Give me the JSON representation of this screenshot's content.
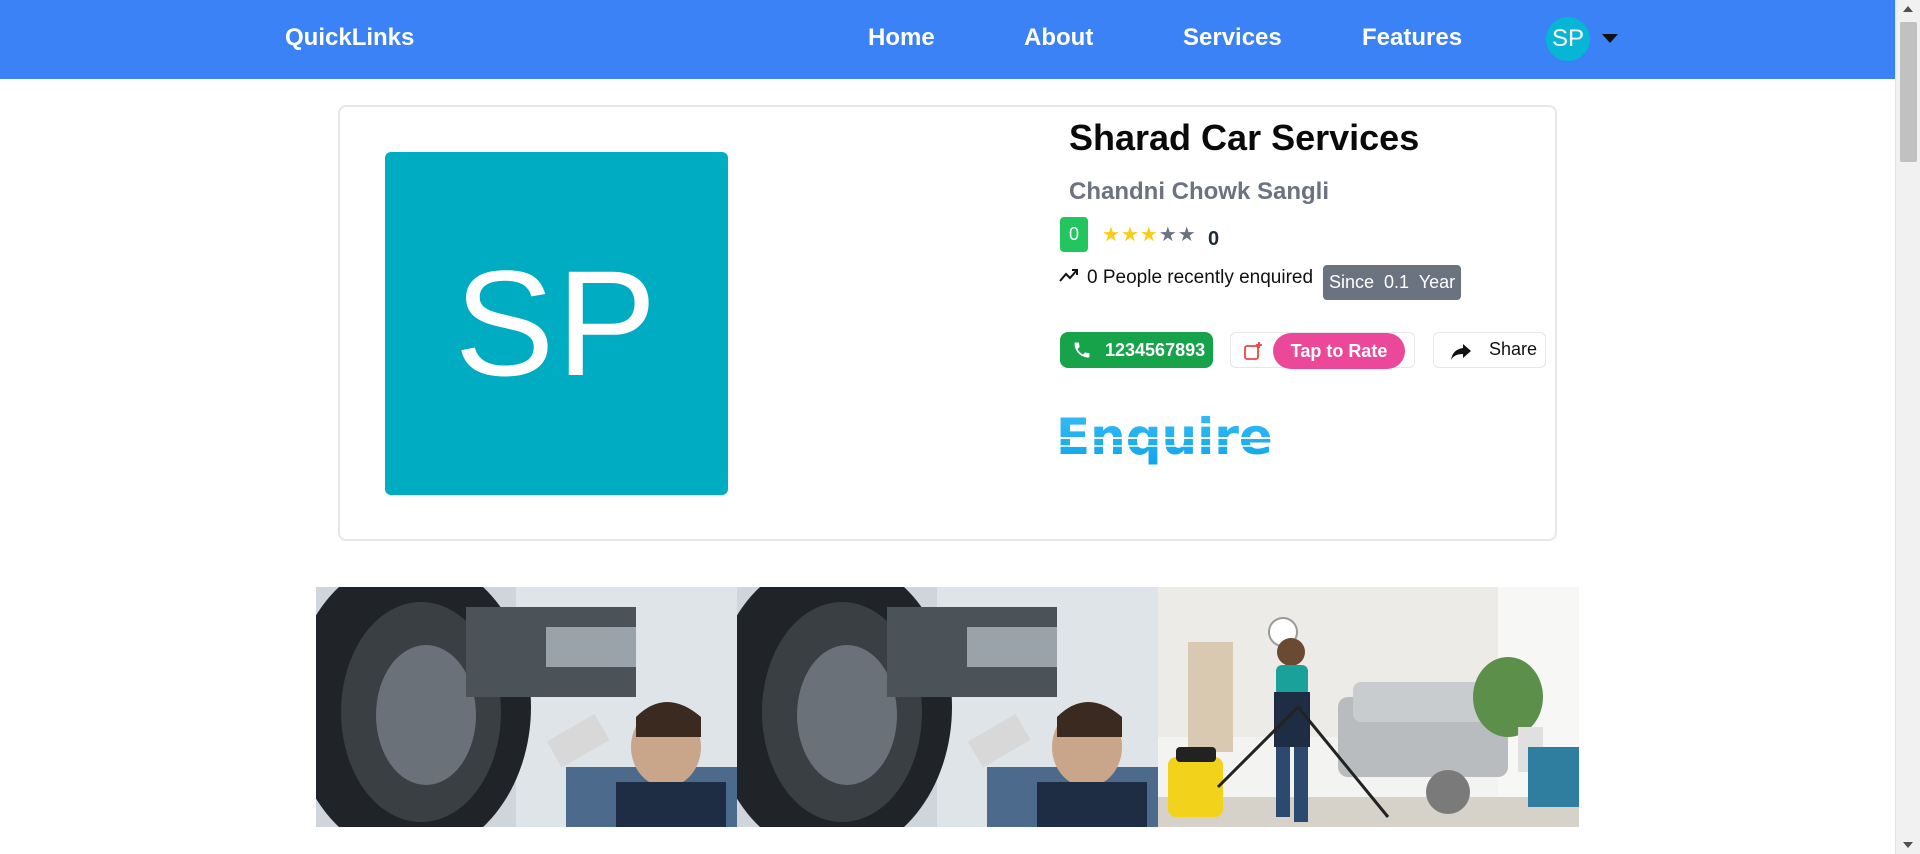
{
  "navbar": {
    "brand": "QuickLinks",
    "items": [
      {
        "label": "Home"
      },
      {
        "label": "About"
      },
      {
        "label": "Services"
      },
      {
        "label": "Features"
      }
    ],
    "avatar_initials": "SP",
    "background_color": "#3b82f6"
  },
  "business": {
    "logo_initials": "SP",
    "logo_color": "#00acc1",
    "name": "Sharad Car Services",
    "location": "Chandni Chowk Sangli",
    "rating_badge": "0",
    "star_rating": 3,
    "star_max": 5,
    "rating_count": "0",
    "enquired_text": "0 People recently enquired",
    "since_text": "Since  0.1  Year"
  },
  "actions": {
    "phone": "1234567893",
    "rate_label": "Tap to Rate",
    "share_label": "Share",
    "enquire_label": "Enquire"
  },
  "gallery": {
    "images": [
      {
        "icon": "mechanic-under-car-photo"
      },
      {
        "icon": "mechanic-under-car-photo"
      },
      {
        "icon": "cleaner-vacuuming-living-room-photo"
      }
    ]
  },
  "colors": {
    "phone_green": "#16a34a",
    "rate_pink": "#ec4899",
    "badge_green": "#22c55e",
    "enquire_blue": "#1eaaf1"
  }
}
